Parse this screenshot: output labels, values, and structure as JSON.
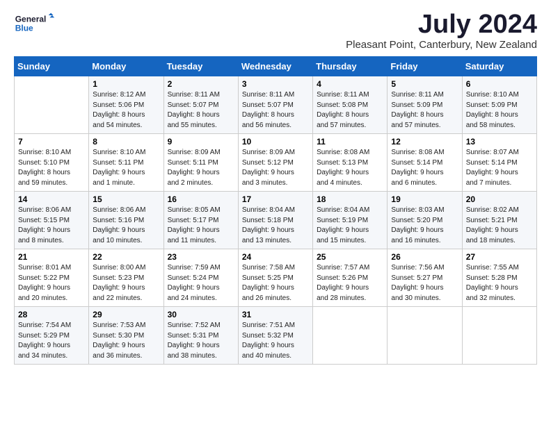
{
  "logo": {
    "line1": "General",
    "line2": "Blue"
  },
  "title": "July 2024",
  "subtitle": "Pleasant Point, Canterbury, New Zealand",
  "days_header": [
    "Sunday",
    "Monday",
    "Tuesday",
    "Wednesday",
    "Thursday",
    "Friday",
    "Saturday"
  ],
  "weeks": [
    [
      {
        "day": "",
        "sunrise": "",
        "sunset": "",
        "daylight": ""
      },
      {
        "day": "1",
        "sunrise": "Sunrise: 8:12 AM",
        "sunset": "Sunset: 5:06 PM",
        "daylight": "Daylight: 8 hours and 54 minutes."
      },
      {
        "day": "2",
        "sunrise": "Sunrise: 8:11 AM",
        "sunset": "Sunset: 5:07 PM",
        "daylight": "Daylight: 8 hours and 55 minutes."
      },
      {
        "day": "3",
        "sunrise": "Sunrise: 8:11 AM",
        "sunset": "Sunset: 5:07 PM",
        "daylight": "Daylight: 8 hours and 56 minutes."
      },
      {
        "day": "4",
        "sunrise": "Sunrise: 8:11 AM",
        "sunset": "Sunset: 5:08 PM",
        "daylight": "Daylight: 8 hours and 57 minutes."
      },
      {
        "day": "5",
        "sunrise": "Sunrise: 8:11 AM",
        "sunset": "Sunset: 5:09 PM",
        "daylight": "Daylight: 8 hours and 57 minutes."
      },
      {
        "day": "6",
        "sunrise": "Sunrise: 8:10 AM",
        "sunset": "Sunset: 5:09 PM",
        "daylight": "Daylight: 8 hours and 58 minutes."
      }
    ],
    [
      {
        "day": "7",
        "sunrise": "Sunrise: 8:10 AM",
        "sunset": "Sunset: 5:10 PM",
        "daylight": "Daylight: 8 hours and 59 minutes."
      },
      {
        "day": "8",
        "sunrise": "Sunrise: 8:10 AM",
        "sunset": "Sunset: 5:11 PM",
        "daylight": "Daylight: 9 hours and 1 minute."
      },
      {
        "day": "9",
        "sunrise": "Sunrise: 8:09 AM",
        "sunset": "Sunset: 5:11 PM",
        "daylight": "Daylight: 9 hours and 2 minutes."
      },
      {
        "day": "10",
        "sunrise": "Sunrise: 8:09 AM",
        "sunset": "Sunset: 5:12 PM",
        "daylight": "Daylight: 9 hours and 3 minutes."
      },
      {
        "day": "11",
        "sunrise": "Sunrise: 8:08 AM",
        "sunset": "Sunset: 5:13 PM",
        "daylight": "Daylight: 9 hours and 4 minutes."
      },
      {
        "day": "12",
        "sunrise": "Sunrise: 8:08 AM",
        "sunset": "Sunset: 5:14 PM",
        "daylight": "Daylight: 9 hours and 6 minutes."
      },
      {
        "day": "13",
        "sunrise": "Sunrise: 8:07 AM",
        "sunset": "Sunset: 5:14 PM",
        "daylight": "Daylight: 9 hours and 7 minutes."
      }
    ],
    [
      {
        "day": "14",
        "sunrise": "Sunrise: 8:06 AM",
        "sunset": "Sunset: 5:15 PM",
        "daylight": "Daylight: 9 hours and 8 minutes."
      },
      {
        "day": "15",
        "sunrise": "Sunrise: 8:06 AM",
        "sunset": "Sunset: 5:16 PM",
        "daylight": "Daylight: 9 hours and 10 minutes."
      },
      {
        "day": "16",
        "sunrise": "Sunrise: 8:05 AM",
        "sunset": "Sunset: 5:17 PM",
        "daylight": "Daylight: 9 hours and 11 minutes."
      },
      {
        "day": "17",
        "sunrise": "Sunrise: 8:04 AM",
        "sunset": "Sunset: 5:18 PM",
        "daylight": "Daylight: 9 hours and 13 minutes."
      },
      {
        "day": "18",
        "sunrise": "Sunrise: 8:04 AM",
        "sunset": "Sunset: 5:19 PM",
        "daylight": "Daylight: 9 hours and 15 minutes."
      },
      {
        "day": "19",
        "sunrise": "Sunrise: 8:03 AM",
        "sunset": "Sunset: 5:20 PM",
        "daylight": "Daylight: 9 hours and 16 minutes."
      },
      {
        "day": "20",
        "sunrise": "Sunrise: 8:02 AM",
        "sunset": "Sunset: 5:21 PM",
        "daylight": "Daylight: 9 hours and 18 minutes."
      }
    ],
    [
      {
        "day": "21",
        "sunrise": "Sunrise: 8:01 AM",
        "sunset": "Sunset: 5:22 PM",
        "daylight": "Daylight: 9 hours and 20 minutes."
      },
      {
        "day": "22",
        "sunrise": "Sunrise: 8:00 AM",
        "sunset": "Sunset: 5:23 PM",
        "daylight": "Daylight: 9 hours and 22 minutes."
      },
      {
        "day": "23",
        "sunrise": "Sunrise: 7:59 AM",
        "sunset": "Sunset: 5:24 PM",
        "daylight": "Daylight: 9 hours and 24 minutes."
      },
      {
        "day": "24",
        "sunrise": "Sunrise: 7:58 AM",
        "sunset": "Sunset: 5:25 PM",
        "daylight": "Daylight: 9 hours and 26 minutes."
      },
      {
        "day": "25",
        "sunrise": "Sunrise: 7:57 AM",
        "sunset": "Sunset: 5:26 PM",
        "daylight": "Daylight: 9 hours and 28 minutes."
      },
      {
        "day": "26",
        "sunrise": "Sunrise: 7:56 AM",
        "sunset": "Sunset: 5:27 PM",
        "daylight": "Daylight: 9 hours and 30 minutes."
      },
      {
        "day": "27",
        "sunrise": "Sunrise: 7:55 AM",
        "sunset": "Sunset: 5:28 PM",
        "daylight": "Daylight: 9 hours and 32 minutes."
      }
    ],
    [
      {
        "day": "28",
        "sunrise": "Sunrise: 7:54 AM",
        "sunset": "Sunset: 5:29 PM",
        "daylight": "Daylight: 9 hours and 34 minutes."
      },
      {
        "day": "29",
        "sunrise": "Sunrise: 7:53 AM",
        "sunset": "Sunset: 5:30 PM",
        "daylight": "Daylight: 9 hours and 36 minutes."
      },
      {
        "day": "30",
        "sunrise": "Sunrise: 7:52 AM",
        "sunset": "Sunset: 5:31 PM",
        "daylight": "Daylight: 9 hours and 38 minutes."
      },
      {
        "day": "31",
        "sunrise": "Sunrise: 7:51 AM",
        "sunset": "Sunset: 5:32 PM",
        "daylight": "Daylight: 9 hours and 40 minutes."
      },
      {
        "day": "",
        "sunrise": "",
        "sunset": "",
        "daylight": ""
      },
      {
        "day": "",
        "sunrise": "",
        "sunset": "",
        "daylight": ""
      },
      {
        "day": "",
        "sunrise": "",
        "sunset": "",
        "daylight": ""
      }
    ]
  ]
}
